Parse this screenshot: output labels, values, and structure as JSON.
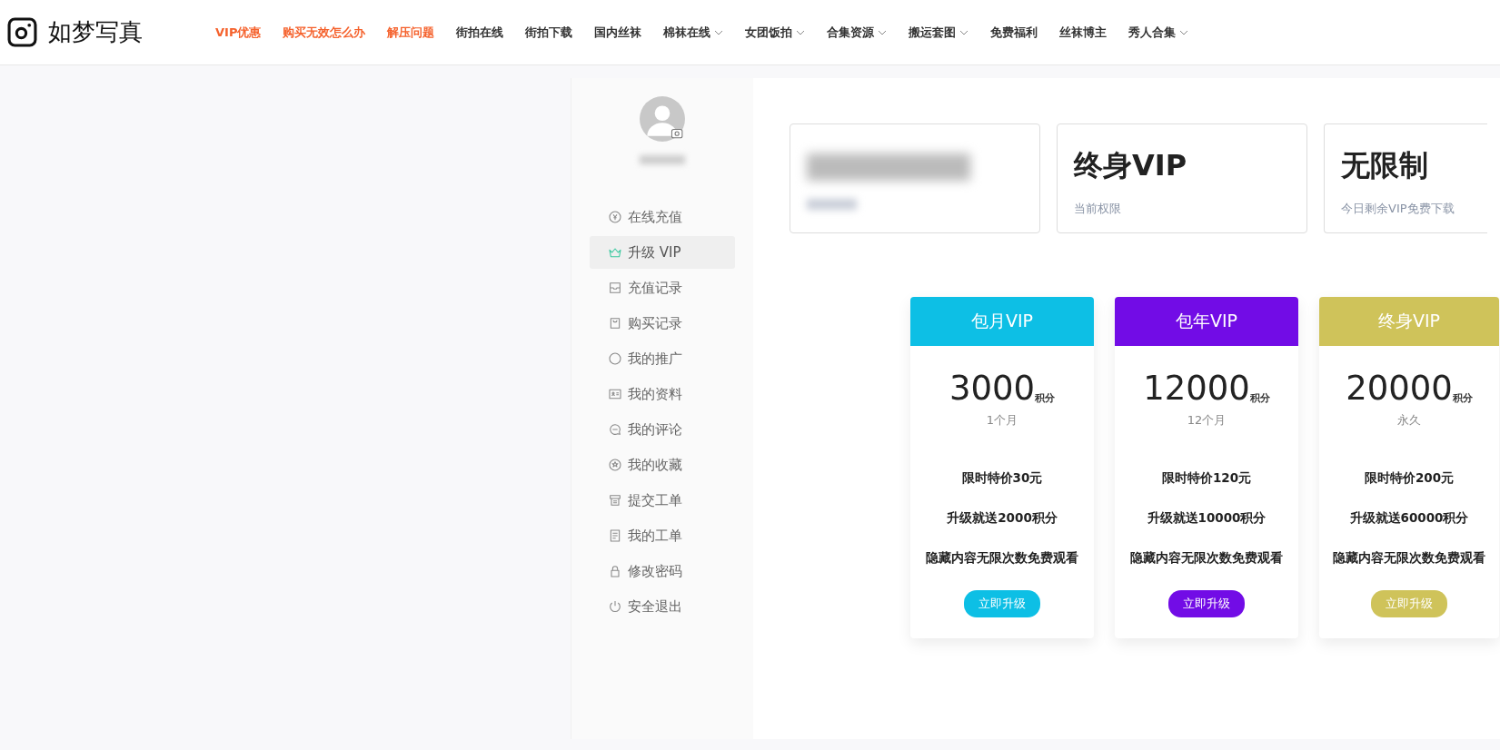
{
  "site": {
    "name": "如梦写真"
  },
  "nav": [
    {
      "label": "VIP优惠",
      "highlighted": true,
      "dropdown": false
    },
    {
      "label": "购买无效怎么办",
      "highlighted": true,
      "dropdown": false
    },
    {
      "label": "解压问题",
      "highlighted": true,
      "dropdown": false
    },
    {
      "label": "街拍在线",
      "highlighted": false,
      "dropdown": false
    },
    {
      "label": "街拍下载",
      "highlighted": false,
      "dropdown": false
    },
    {
      "label": "国内丝袜",
      "highlighted": false,
      "dropdown": false
    },
    {
      "label": "棉袜在线",
      "highlighted": false,
      "dropdown": true
    },
    {
      "label": "女团饭拍",
      "highlighted": false,
      "dropdown": true
    },
    {
      "label": "合集资源",
      "highlighted": false,
      "dropdown": true
    },
    {
      "label": "搬运套图",
      "highlighted": false,
      "dropdown": true
    },
    {
      "label": "免费福利",
      "highlighted": false,
      "dropdown": false
    },
    {
      "label": "丝袜博主",
      "highlighted": false,
      "dropdown": false
    },
    {
      "label": "秀人合集",
      "highlighted": false,
      "dropdown": true
    }
  ],
  "profile": {
    "name_hidden": true
  },
  "sidebar": {
    "items": [
      {
        "label": "在线充值",
        "selected": false
      },
      {
        "label": "升级 VIP",
        "selected": true
      },
      {
        "label": "充值记录",
        "selected": false
      },
      {
        "label": "购买记录",
        "selected": false
      },
      {
        "label": "我的推广",
        "selected": false
      },
      {
        "label": "我的资料",
        "selected": false
      },
      {
        "label": "我的评论",
        "selected": false
      },
      {
        "label": "我的收藏",
        "selected": false
      },
      {
        "label": "提交工单",
        "selected": false
      },
      {
        "label": "我的工单",
        "selected": false
      },
      {
        "label": "修改密码",
        "selected": false
      },
      {
        "label": "安全退出",
        "selected": false
      }
    ]
  },
  "stats": [
    {
      "kind": "blurred"
    },
    {
      "kind": "plain",
      "value": "终身VIP",
      "label": "当前权限"
    },
    {
      "kind": "plain",
      "value": "无限制",
      "label": "今日剩余VIP免费下载"
    }
  ],
  "plans": [
    {
      "title": "包月VIP",
      "color": "#0dbfe5",
      "price": "3000",
      "unit": "积分",
      "period": "1个月",
      "features": [
        "限时特价30元",
        "升级就送2000积分",
        "隐藏内容无限次数免费观看"
      ],
      "button": "立即升级"
    },
    {
      "title": "包年VIP",
      "color": "#720ce6",
      "price": "12000",
      "unit": "积分",
      "period": "12个月",
      "features": [
        "限时特价120元",
        "升级就送10000积分",
        "隐藏内容无限次数免费观看"
      ],
      "button": "立即升级"
    },
    {
      "title": "终身VIP",
      "color": "#cfc35a",
      "price": "20000",
      "unit": "积分",
      "period": "永久",
      "features": [
        "限时特价200元",
        "升级就送60000积分",
        "隐藏内容无限次数免费观看"
      ],
      "button": "立即升级"
    }
  ]
}
